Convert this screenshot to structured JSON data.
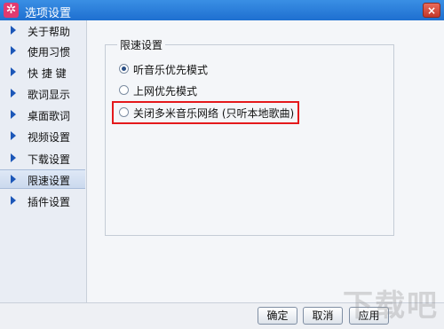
{
  "window": {
    "title": "选项设置",
    "app_icon": "star-icon",
    "close_glyph": "×"
  },
  "sidebar": {
    "items": [
      {
        "label": "关于帮助"
      },
      {
        "label": "使用习惯"
      },
      {
        "label": "快 捷 键"
      },
      {
        "label": "歌词显示"
      },
      {
        "label": "桌面歌词"
      },
      {
        "label": "视频设置"
      },
      {
        "label": "下载设置"
      },
      {
        "label": "限速设置"
      },
      {
        "label": "插件设置"
      }
    ],
    "active_index": 7
  },
  "content": {
    "group_title": "限速设置",
    "options": [
      {
        "label": "听音乐优先模式",
        "checked": true
      },
      {
        "label": "上网优先模式",
        "checked": false
      },
      {
        "label": "关闭多米音乐网络 (只听本地歌曲)",
        "checked": false
      }
    ],
    "highlight_color": "#e4191c"
  },
  "buttons": {
    "ok": "确定",
    "cancel": "取消",
    "apply": "应用"
  },
  "watermark": "下载吧"
}
